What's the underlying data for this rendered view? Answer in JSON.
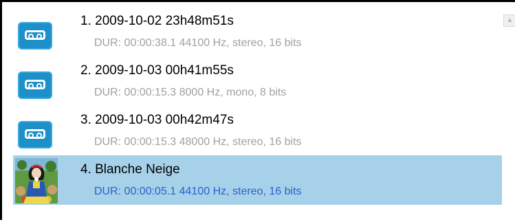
{
  "recordings": [
    {
      "index_title": "1. 2009-10-02 23h48m51s",
      "info": "DUR: 00:00:38.1   44100 Hz, stereo, 16 bits",
      "icon": "cassette-tape-icon",
      "selected": false
    },
    {
      "index_title": "2. 2009-10-03 00h41m55s",
      "info": "DUR: 00:00:15.3   8000 Hz, mono, 8 bits",
      "icon": "cassette-tape-icon",
      "selected": false
    },
    {
      "index_title": "3. 2009-10-03 00h42m47s",
      "info": "DUR: 00:00:15.3   48000 Hz, stereo, 16 bits",
      "icon": "cassette-tape-icon",
      "selected": false
    },
    {
      "index_title": "4. Blanche Neige",
      "info": "DUR: 00:00:05.1   44100 Hz, stereo, 16 bits",
      "icon": "snow-white-thumbnail",
      "selected": true
    }
  ],
  "colors": {
    "selection": "#a6d1e8",
    "cassette": "#1d8fc9",
    "info_text": "#a0a0a0",
    "selected_info_text": "#2a5fd0"
  },
  "scrollbar": {
    "up_glyph": "▲"
  }
}
